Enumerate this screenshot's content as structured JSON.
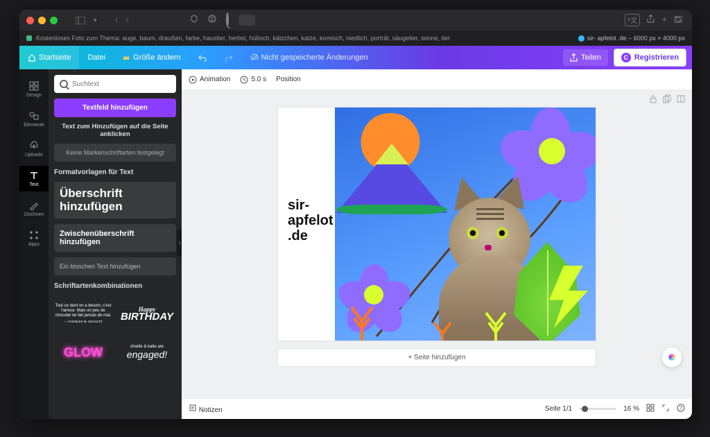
{
  "titlebar": {
    "tab_title": "Kostenloses Foto zum Thema: auge, baum, draußen, farbe, haustier, herbst, hübsch, kätzchen, katze, komisch, niedlich, porträt, säugetier, sonne, tier",
    "tab_meta": "sir- apfelot .de – 6000 px × 4000 px"
  },
  "appbar": {
    "home": "Startseite",
    "file": "Datei",
    "resize": "Größe ändern",
    "unsaved": "Nicht gespeicherte Änderungen",
    "share": "Teilen",
    "register": "Registrieren",
    "reg_initial": "C"
  },
  "rail": {
    "items": [
      {
        "label": "Design"
      },
      {
        "label": "Elemente"
      },
      {
        "label": "Uploads"
      },
      {
        "label": "Text"
      },
      {
        "label": "Zeichnen"
      },
      {
        "label": "Apps"
      }
    ]
  },
  "panel": {
    "search_placeholder": "Suchtext",
    "add_textbox": "Textfeld hinzufügen",
    "click_to_add": "Text zum Hinzufügen auf die Seite anklicken",
    "no_brand_fonts": "Keine Markenschriftarten festgelegt",
    "templates_h": "Formatvorlagen für Text",
    "tmpl_h1_a": "Überschrift",
    "tmpl_h1_b": "hinzufügen",
    "tmpl_h2": "Zwischenüberschrift hinzufügen",
    "tmpl_body": "Ein bisschen Text hinzufügen",
    "combos_h": "Schriftartenkombinationen",
    "combo1": "Tout ce dont on a besoin, c'est l'amour. Mais un peu de chocolat ne fait jamais de mal.",
    "combo1_by": "— CHARLES M. SCHULTZ",
    "combo2_top": "Happy",
    "combo2": "BIRTHDAY",
    "combo3": "GLOW",
    "combo4_top": "charlie & katie are",
    "combo4": "engaged!"
  },
  "stage_top": {
    "animation": "Animation",
    "duration": "5.0 s",
    "position": "Position"
  },
  "canvas": {
    "text_l1": "sir-",
    "text_l2": "apfelot",
    "text_l3": ".de",
    "add_page": "+ Seite hinzufügen"
  },
  "stage_bottom": {
    "notes": "Notizen",
    "page": "Seite 1/1",
    "zoom": "16 %"
  }
}
